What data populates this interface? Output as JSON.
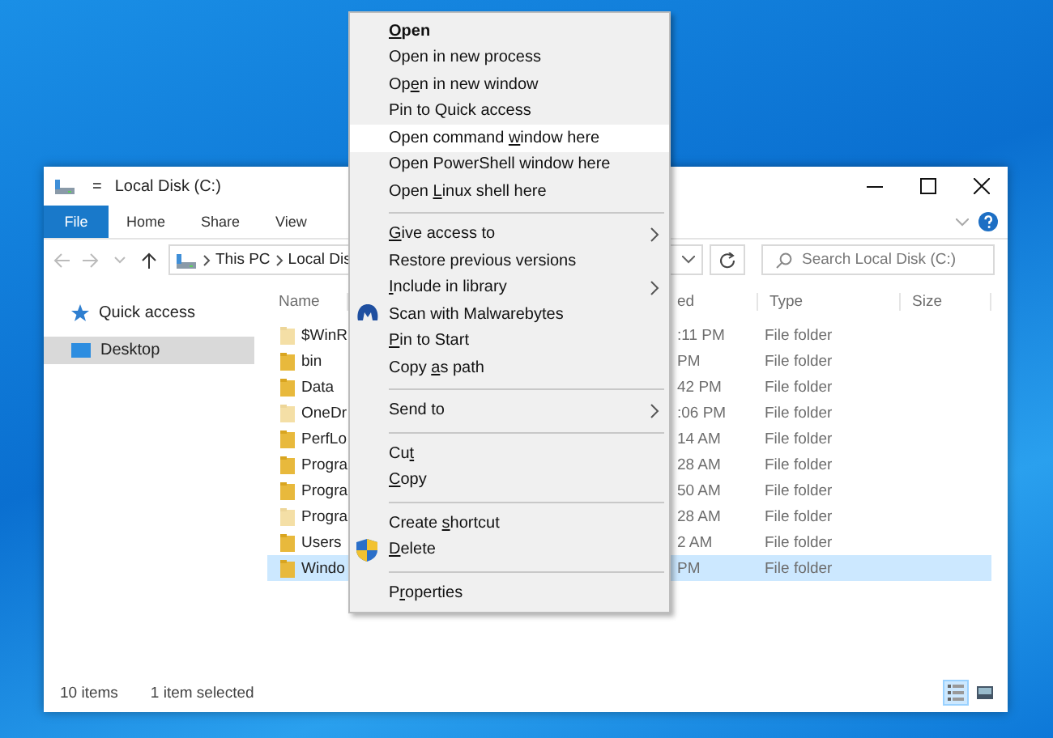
{
  "window": {
    "title": "Local Disk (C:)",
    "toolbar_glyph": "="
  },
  "ribbon_tabs": [
    {
      "label": "File",
      "kind": "file"
    },
    {
      "label": "Home",
      "kind": "tab"
    },
    {
      "label": "Share",
      "kind": "tab"
    },
    {
      "label": "View",
      "kind": "tab"
    }
  ],
  "address": {
    "path": [
      "This PC",
      "Local Dis"
    ]
  },
  "search": {
    "placeholder": "Search Local Disk (C:)"
  },
  "nav": [
    {
      "label": "Quick access",
      "kind": "star",
      "selected": false
    },
    {
      "label": "Desktop",
      "kind": "desktop",
      "selected": true
    }
  ],
  "columns": [
    {
      "label": "Name"
    },
    {
      "label": "ed"
    },
    {
      "label": "Type"
    },
    {
      "label": "Size"
    }
  ],
  "rows": [
    {
      "name": "$WinR",
      "modified": ":11 PM",
      "type": "File folder",
      "hidden": true,
      "selected": false
    },
    {
      "name": "bin",
      "modified": "PM",
      "type": "File folder",
      "hidden": false,
      "selected": false
    },
    {
      "name": "Data",
      "modified": "42 PM",
      "type": "File folder",
      "hidden": false,
      "selected": false
    },
    {
      "name": "OneDr",
      "modified": ":06 PM",
      "type": "File folder",
      "hidden": true,
      "selected": false
    },
    {
      "name": "PerfLo",
      "modified": "14 AM",
      "type": "File folder",
      "hidden": false,
      "selected": false
    },
    {
      "name": "Progra",
      "modified": "28 AM",
      "type": "File folder",
      "hidden": false,
      "selected": false
    },
    {
      "name": "Progra",
      "modified": "50 AM",
      "type": "File folder",
      "hidden": false,
      "selected": false
    },
    {
      "name": "Progra",
      "modified": "28 AM",
      "type": "File folder",
      "hidden": true,
      "selected": false
    },
    {
      "name": "Users",
      "modified": "2 AM",
      "type": "File folder",
      "hidden": false,
      "selected": false
    },
    {
      "name": "Windo",
      "modified": "PM",
      "type": "File folder",
      "hidden": false,
      "selected": true
    }
  ],
  "status_bar": {
    "count": "10 items",
    "selection": "1 item selected"
  },
  "view_buttons": [
    {
      "kind": "details",
      "selected": true
    },
    {
      "kind": "tiles",
      "selected": false
    }
  ],
  "context_menu": [
    {
      "kind": "item",
      "key": "O",
      "after": "pen",
      "bold": true,
      "highlighted": false,
      "submenu": false
    },
    {
      "kind": "item",
      "label": "Open in new process",
      "bold": false,
      "highlighted": false,
      "submenu": false
    },
    {
      "kind": "item",
      "before": "Op",
      "key": "e",
      "after": "n in new window",
      "bold": false,
      "highlighted": false,
      "submenu": false
    },
    {
      "kind": "item",
      "label": "Pin to Quick access",
      "bold": false,
      "highlighted": false,
      "submenu": false
    },
    {
      "kind": "item",
      "before": "Open command ",
      "key": "w",
      "after": "indow here",
      "bold": false,
      "highlighted": true,
      "submenu": false
    },
    {
      "kind": "item",
      "label": "Open PowerShell window here",
      "bold": false,
      "highlighted": false,
      "submenu": false
    },
    {
      "kind": "item",
      "before": "Open ",
      "key": "L",
      "after": "inux shell here",
      "bold": false,
      "highlighted": false,
      "submenu": false
    },
    {
      "kind": "separator"
    },
    {
      "kind": "item",
      "key": "G",
      "after": "ive access to",
      "bold": false,
      "highlighted": false,
      "submenu": true
    },
    {
      "kind": "item",
      "label": "Restore previous versions",
      "bold": false,
      "highlighted": false,
      "submenu": false
    },
    {
      "kind": "item",
      "key": "I",
      "after": "nclude in library",
      "bold": false,
      "highlighted": false,
      "submenu": true
    },
    {
      "kind": "scanner-item",
      "label": "Scan with Malwarebytes",
      "bold": false,
      "highlighted": false,
      "submenu": false
    },
    {
      "kind": "item",
      "key": "P",
      "after": "in to Start",
      "bold": false,
      "highlighted": false,
      "submenu": false
    },
    {
      "kind": "item",
      "before": "Copy ",
      "key": "a",
      "after": "s path",
      "bold": false,
      "highlighted": false,
      "submenu": false
    },
    {
      "kind": "separator"
    },
    {
      "kind": "item",
      "label": "Send to",
      "bold": false,
      "highlighted": false,
      "submenu": true
    },
    {
      "kind": "separator"
    },
    {
      "kind": "item",
      "before": "Cu",
      "key": "t",
      "bold": false,
      "highlighted": false,
      "submenu": false
    },
    {
      "kind": "item",
      "key": "C",
      "after": "opy",
      "bold": false,
      "highlighted": false,
      "submenu": false
    },
    {
      "kind": "separator"
    },
    {
      "kind": "item",
      "before": "Create ",
      "key": "s",
      "after": "hortcut",
      "bold": false,
      "highlighted": false,
      "submenu": false
    },
    {
      "kind": "shield-item",
      "key": "D",
      "after": "elete",
      "bold": false,
      "highlighted": false,
      "submenu": false
    },
    {
      "kind": "separator"
    },
    {
      "kind": "item",
      "before": "P",
      "key": "r",
      "after": "operties",
      "bold": false,
      "highlighted": false,
      "submenu": false
    }
  ]
}
